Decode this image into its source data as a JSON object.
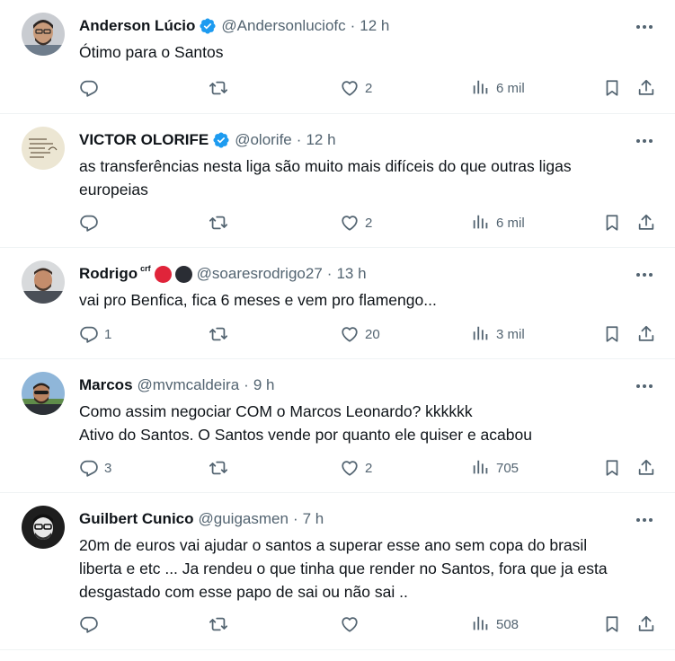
{
  "tweets": [
    {
      "name": "Anderson Lúcio",
      "verified": true,
      "handle": "@Andersonluciofc",
      "sep": "·",
      "time": "12 h",
      "lines": [
        "Ótimo para o Santos"
      ],
      "replies": "",
      "retweets": "",
      "likes": "2",
      "views": "6 mil"
    },
    {
      "name": "VICTOR OLORIFE",
      "verified": true,
      "handle": "@olorife",
      "sep": "·",
      "time": "12 h",
      "lines": [
        "as transferências nesta liga são muito mais difíceis do que outras ligas",
        "europeias"
      ],
      "replies": "",
      "retweets": "",
      "likes": "2",
      "views": "6 mil"
    },
    {
      "name": "Rodrigo",
      "name_suffix": "crf",
      "badge_colors": [
        "#e0243a",
        "#2a2d34"
      ],
      "verified": false,
      "handle": "@soaresrodrigo27",
      "sep": "·",
      "time": "13 h",
      "lines": [
        "vai pro Benfica, fica 6 meses e vem pro flamengo..."
      ],
      "replies": "1",
      "retweets": "",
      "likes": "20",
      "views": "3 mil"
    },
    {
      "name": "Marcos",
      "verified": false,
      "handle": "@mvmcaldeira",
      "sep": "·",
      "time": "9 h",
      "lines": [
        "Como assim negociar COM o Marcos Leonardo? kkkkkk",
        "Ativo do Santos. O Santos vende por quanto ele quiser e acabou"
      ],
      "replies": "3",
      "retweets": "",
      "likes": "2",
      "views": "705"
    },
    {
      "name": "Guilbert Cunico",
      "verified": false,
      "handle": "@guigasmen",
      "sep": "·",
      "time": "7 h",
      "lines": [
        "20m de euros vai ajudar o santos a superar esse ano sem copa do brasil",
        "liberta e etc ... Ja rendeu o que tinha que render no Santos, fora que ja esta",
        "desgastado com esse papo de sai ou não sai .."
      ],
      "replies": "",
      "retweets": "",
      "likes": "",
      "views": "508"
    }
  ],
  "icons": {
    "verified": "verified-badge-icon",
    "more": "more-options-icon",
    "reply": "reply-icon",
    "retweet": "retweet-icon",
    "like": "like-icon",
    "views": "views-icon",
    "bookmark": "bookmark-icon",
    "share": "share-icon"
  },
  "colors": {
    "text": "#0f1419",
    "secondary": "#536471",
    "verified_blue": "#1d9bf0",
    "divider": "#eff3f4"
  }
}
